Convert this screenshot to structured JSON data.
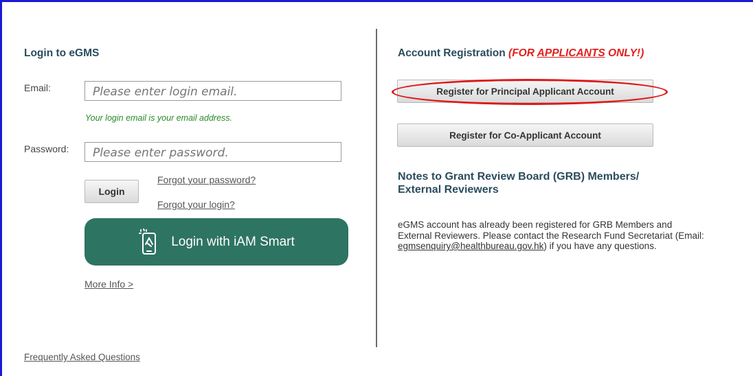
{
  "login": {
    "heading": "Login to eGMS",
    "email_label": "Email:",
    "email_placeholder": "Please enter login email.",
    "email_hint": "Your login email is your email address.",
    "password_label": "Password:",
    "password_placeholder": "Please enter password.",
    "login_button": "Login",
    "forgot_password": "Forgot your password?",
    "forgot_login": "Forgot your login?",
    "iam_smart_button": "Login with iAM Smart",
    "more_info": "More Info >",
    "faq": "Frequently Asked Questions"
  },
  "registration": {
    "heading": "Account Registration",
    "warning_prefix": "(FOR ",
    "warning_emph": "APPLICANTS",
    "warning_suffix": " ONLY!)",
    "principal_button": "Register for Principal Applicant Account",
    "coapplicant_button": "Register for Co-Applicant Account"
  },
  "notes": {
    "heading_line1": "Notes to Grant Review Board (GRB) Members/",
    "heading_line2": "External Reviewers",
    "text_before_email": "eGMS account has already been registered for GRB Members and External Reviewers. Please contact the Research Fund Secretariat (Email: ",
    "email": "egmsenquiry@healthbureau.gov.hk",
    "text_after_email": ") if you have any questions."
  },
  "colors": {
    "frame_border": "#1a1ad6",
    "heading": "#2b4c5e",
    "hint": "#2a8a2a",
    "iam_smart": "#2e7462",
    "warning": "#e0201c",
    "highlight_ellipse": "#e01818"
  },
  "icons": {
    "iam_smart": "smartphone-iam-icon"
  }
}
